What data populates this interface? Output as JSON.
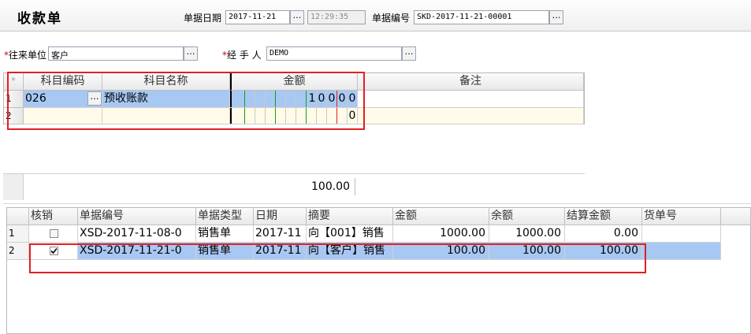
{
  "header": {
    "title": "收款单",
    "date_label": "单据日期",
    "date_value": "2017-11-21",
    "time_value": "12:29:35",
    "docno_label": "单据编号",
    "docno_value": "SKD-2017-11-21-00001",
    "ellipsis": "…"
  },
  "form": {
    "required_mark": "*",
    "partner_label": "往来单位",
    "partner_value": "客户",
    "handler_label": "经 手 人",
    "handler_value": "DEMO"
  },
  "top_grid": {
    "corner": "*",
    "columns": [
      "科目编码",
      "科目名称",
      "金额",
      "备注"
    ],
    "rows": [
      {
        "no": "1",
        "code": "026",
        "name": "预收账款",
        "amount_digits": [
          "1",
          "0",
          "0",
          "0",
          "0"
        ],
        "remark": ""
      },
      {
        "no": "2",
        "code": "",
        "name": "",
        "amount_digits": [
          "0"
        ],
        "remark": ""
      }
    ],
    "total": "100.00"
  },
  "splitter": "....",
  "bottom_grid": {
    "columns": [
      "核销",
      "单据编号",
      "单据类型",
      "日期",
      "摘要",
      "金额",
      "余额",
      "结算金额",
      "货单号"
    ],
    "rows": [
      {
        "no": "1",
        "checked": false,
        "docno": "XSD-2017-11-08-0",
        "type": "销售单",
        "date": "2017-11",
        "summary": "向【001】销售",
        "amount": "1000.00",
        "balance": "1000.00",
        "settle": "0.00",
        "cargo": ""
      },
      {
        "no": "2",
        "checked": true,
        "docno": "XSD-2017-11-21-0",
        "type": "销售单",
        "date": "2017-11",
        "summary": "向【客户】销售",
        "amount": "100.00",
        "balance": "100.00",
        "settle": "100.00",
        "cargo": ""
      }
    ]
  },
  "colors": {
    "selection": "#a8c8f4",
    "highlight_box": "#e02020"
  }
}
